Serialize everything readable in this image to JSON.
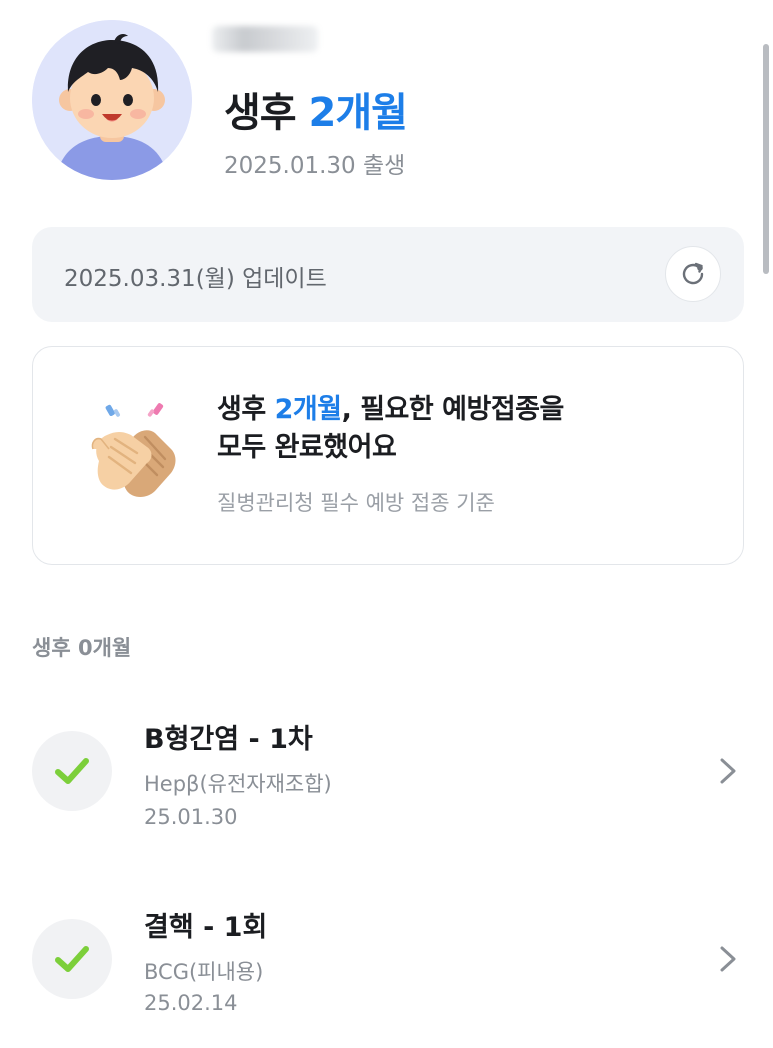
{
  "profile": {
    "age_prefix": "생후 ",
    "age_value": "2개월",
    "birth": "2025.01.30 출생"
  },
  "update": {
    "text": "2025.03.31(월) 업데이트",
    "refresh_icon": "refresh-icon"
  },
  "card": {
    "title_prefix": "생후 ",
    "title_accent": "2개월",
    "title_rest": ", 필요한 예방접종을",
    "title_line2": "모두 완료했어요",
    "subtitle": "질병관리청 필수 예방 접종 기준",
    "icon": "clapping-hands-icon"
  },
  "section": {
    "label": "생후 0개월"
  },
  "vaccines": [
    {
      "name": "B형간염 - 1차",
      "type": "Hepβ(유전자재조합)",
      "date": "25.01.30",
      "status": "completed"
    },
    {
      "name": "결핵 - 1회",
      "type": "BCG(피내용)",
      "date": "25.02.14",
      "status": "completed"
    }
  ],
  "colors": {
    "accent": "#1d7ee8",
    "check": "#7ccf3a",
    "muted": "#8a8f96"
  }
}
